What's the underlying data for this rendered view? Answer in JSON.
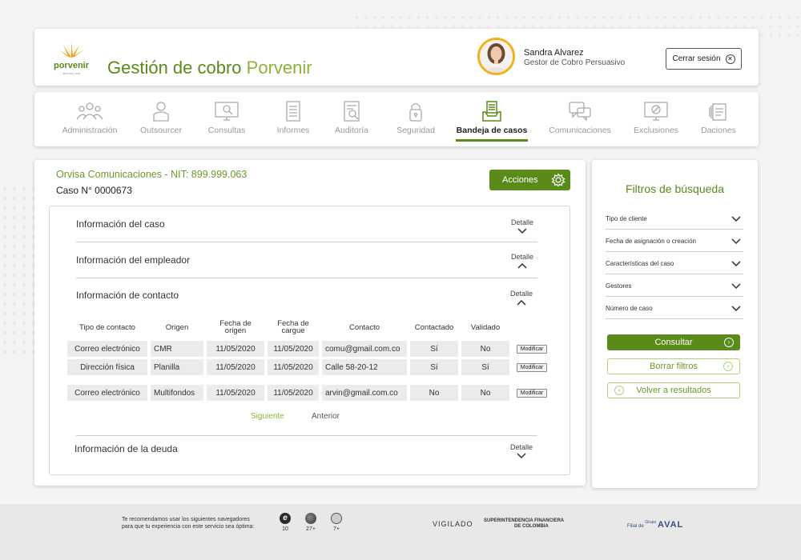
{
  "app": {
    "logo_word": "porvenir",
    "logo_tagline": "otra hay una",
    "title_main": "Gestión de cobro",
    "title_brand": "Porvenir",
    "brand_color": "#5a8a1a",
    "accent_color": "#8db33a"
  },
  "user": {
    "name": "Sandra Alvarez",
    "role": "Gestor de Cobro Persuasivo",
    "logout_label": "Cerrar sesión"
  },
  "nav": {
    "items": [
      {
        "label": "Administración",
        "icon": "users-group-icon"
      },
      {
        "label": "Outsourcer",
        "icon": "person-icon"
      },
      {
        "label": "Consultas",
        "icon": "monitor-search-icon"
      },
      {
        "label": "Informes",
        "icon": "document-lines-icon"
      },
      {
        "label": "Auditoría",
        "icon": "document-search-icon"
      },
      {
        "label": "Seguridad",
        "icon": "padlock-icon"
      },
      {
        "label": "Bandeja de casos",
        "icon": "inbox-tray-icon",
        "active": true
      },
      {
        "label": "Comunicaciones",
        "icon": "chat-bubbles-icon"
      },
      {
        "label": "Exclusiones",
        "icon": "monitor-block-icon"
      },
      {
        "label": "Daciones",
        "icon": "document-stack-icon"
      }
    ]
  },
  "case": {
    "company": "Orvisa Comunicaciones  -  NIT: 899.999.063",
    "case_number": "Caso N° 0000673",
    "actions_label": "Acciones"
  },
  "sections": {
    "detalle_label": "Detalle",
    "caso": "Información del caso",
    "empleador": "Información del empleador",
    "contacto": "Información de contacto",
    "deuda": "Información de la deuda"
  },
  "contacts": {
    "headers": [
      "Tipo de contacto",
      "Origen",
      "Fecha de origen",
      "Fecha de cargue",
      "Contacto",
      "Contactado",
      "Validado"
    ],
    "modify_label": "Modificar",
    "rows": [
      {
        "tipo": "Correo electrónico",
        "origen": "CMR",
        "fecha_origen": "11/05/2020",
        "fecha_cargue": "11/05/2020",
        "contacto": "comu@gmail.com.co",
        "contactado": "Sí",
        "validado": "No"
      },
      {
        "tipo": "Dirección física",
        "origen": "Planilla",
        "fecha_origen": "11/05/2020",
        "fecha_cargue": "11/05/2020",
        "contacto": "Calle 58-20-12",
        "contactado": "Sí",
        "validado": "Sí"
      },
      {
        "tipo": "Correo electrónico",
        "origen": "Multifondos",
        "fecha_origen": "11/05/2020",
        "fecha_cargue": "11/05/2020",
        "contacto": "arvin@gmail.com.co",
        "contactado": "No",
        "validado": "No"
      }
    ],
    "next_label": "Siguiente",
    "prev_label": "Anterior"
  },
  "filters": {
    "title": "Filtros de búsqueda",
    "items": [
      "Tipo de cliente",
      "Fecha de asignación o creación",
      "Características del caso",
      "Gestores",
      "Número de caso"
    ],
    "consultar": "Consultar",
    "borrar": "Borrar filtros",
    "volver": "Volver a resultados"
  },
  "footer": {
    "recommend_line1": "Te recomendamos usar los siguientes navegadores",
    "recommend_line2": "para que tu experiencia con este servicio sea óptima:",
    "browsers": [
      {
        "icon": "internet-explorer-icon",
        "version": "10"
      },
      {
        "icon": "firefox-icon",
        "version": "27+"
      },
      {
        "icon": "safari-icon",
        "version": "7+"
      }
    ],
    "vigilado": "VIGILADO",
    "superintendencia_line1": "SUPERINTENDENCIA FINANCIERA",
    "superintendencia_line2": "DE COLOMBIA",
    "aval_prefix": "Filial de",
    "aval_group": "Grupo",
    "aval_brand": "AVAL"
  }
}
